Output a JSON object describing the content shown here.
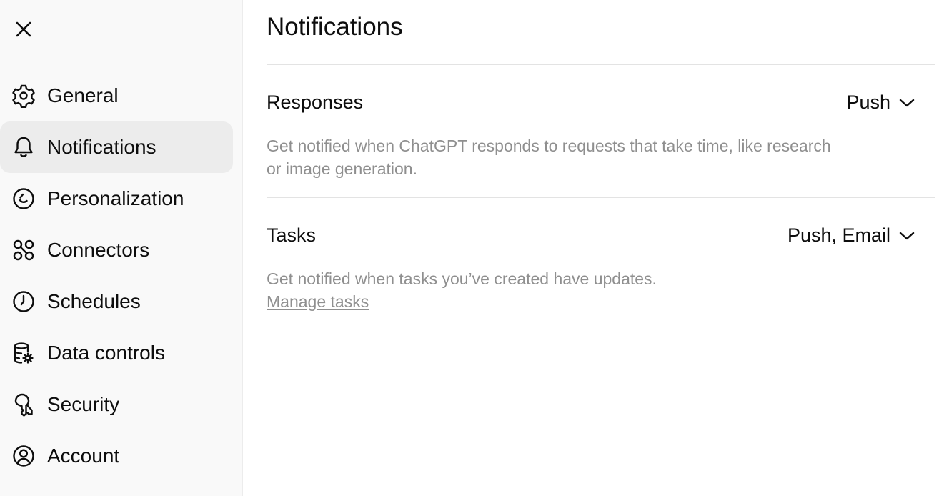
{
  "sidebar": {
    "items": [
      {
        "label": "General",
        "icon": "gear-icon"
      },
      {
        "label": "Notifications",
        "icon": "bell-icon",
        "active": true
      },
      {
        "label": "Personalization",
        "icon": "personalization-icon"
      },
      {
        "label": "Connectors",
        "icon": "connectors-icon"
      },
      {
        "label": "Schedules",
        "icon": "clock-icon"
      },
      {
        "label": "Data controls",
        "icon": "database-settings-icon"
      },
      {
        "label": "Security",
        "icon": "key-icon"
      },
      {
        "label": "Account",
        "icon": "user-circle-icon"
      }
    ]
  },
  "main": {
    "title": "Notifications",
    "sections": [
      {
        "title": "Responses",
        "value": "Push",
        "description": "Get notified when ChatGPT responds to requests that take time, like research or image generation."
      },
      {
        "title": "Tasks",
        "value": "Push, Email",
        "description": "Get notified when tasks you’ve created have updates.",
        "link": "Manage tasks"
      }
    ]
  },
  "colors": {
    "sidebar_bg": "#f9f9f9",
    "active_item_bg": "#ececec",
    "text_primary": "#0d0d0d",
    "text_secondary": "#8f8f8f",
    "divider": "#e3e3e3"
  }
}
